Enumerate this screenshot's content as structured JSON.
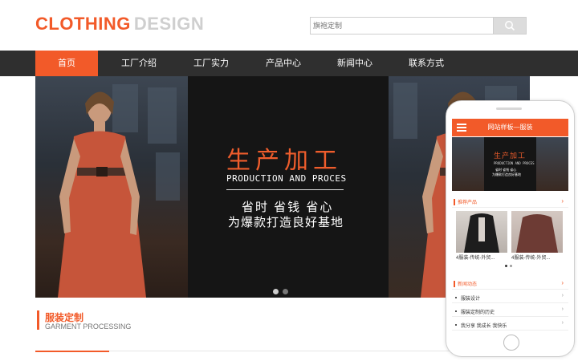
{
  "logo": {
    "part1": "CLOTHING",
    "part2": "DESIGN"
  },
  "search": {
    "placeholder": "旗袍定制",
    "button_icon": "search-icon"
  },
  "nav": {
    "items": [
      {
        "label": "首页",
        "active": true
      },
      {
        "label": "工厂介绍",
        "active": false
      },
      {
        "label": "工厂实力",
        "active": false
      },
      {
        "label": "产品中心",
        "active": false
      },
      {
        "label": "新闻中心",
        "active": false
      },
      {
        "label": "联系方式",
        "active": false
      }
    ]
  },
  "banner": {
    "title": "生产加工",
    "subtitle": "PRODUCTION AND PROCES",
    "line1": "省时 省钱 省心",
    "line2": "为爆款打造良好基地",
    "slide_count": 2,
    "active_slide": 1
  },
  "section": {
    "title": "服装定制",
    "subtitle": "GARMENT PROCESSING"
  },
  "mobile": {
    "header_title": "网站样板—服装",
    "menu_icon": "hamburger-icon",
    "products_label": "推荐产品",
    "products": [
      {
        "caption": "4服装-传统-外贸..."
      },
      {
        "caption": "4服装-传统-外贸..."
      }
    ],
    "news_label": "新闻动态",
    "news": [
      {
        "title": "服装设计"
      },
      {
        "title": "服装定制的历史"
      },
      {
        "title": "我分享 我成长 我快乐"
      }
    ],
    "arrow": "›"
  },
  "colors": {
    "accent": "#f25a29",
    "nav_bg": "#2f2f2f",
    "banner_bg": "#151515"
  }
}
